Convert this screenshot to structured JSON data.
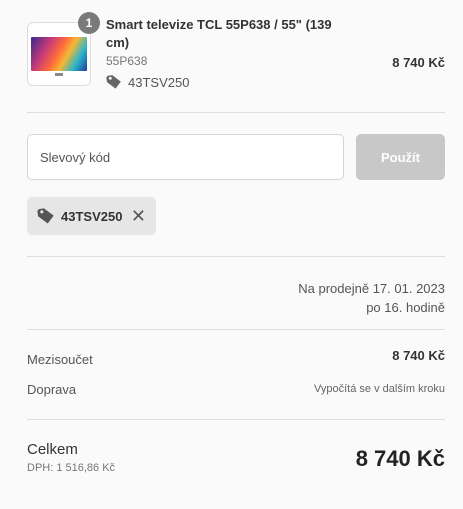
{
  "product": {
    "quantity": "1",
    "name": "Smart televize TCL 55P638 / 55\" (139 cm)",
    "sku": "55P638",
    "discount_tag": "43TSV250",
    "price": "8 740 Kč",
    "thumbnail_icon": "tv-thumbnail"
  },
  "discount": {
    "placeholder": "Slevový kód",
    "value": "",
    "apply_label": "Použít",
    "applied_code": "43TSV250",
    "remove_symbol": "✕"
  },
  "pickup": {
    "line1": "Na prodejně 17. 01. 2023",
    "line2": "po 16. hodině"
  },
  "summary": {
    "subtotal_label": "Mezisoučet",
    "subtotal_value": "8 740 Kč",
    "shipping_label": "Doprava",
    "shipping_value": "Vypočítá se v dalším kroku",
    "total_label": "Celkem",
    "tax_text": "DPH: 1 516,86 Kč",
    "total_value": "8 740 Kč"
  },
  "colors": {
    "background": "#fafafa",
    "apply_button": "#c8c8c8",
    "chip_background": "#e6e6e6",
    "badge": "#7a7a7a"
  }
}
